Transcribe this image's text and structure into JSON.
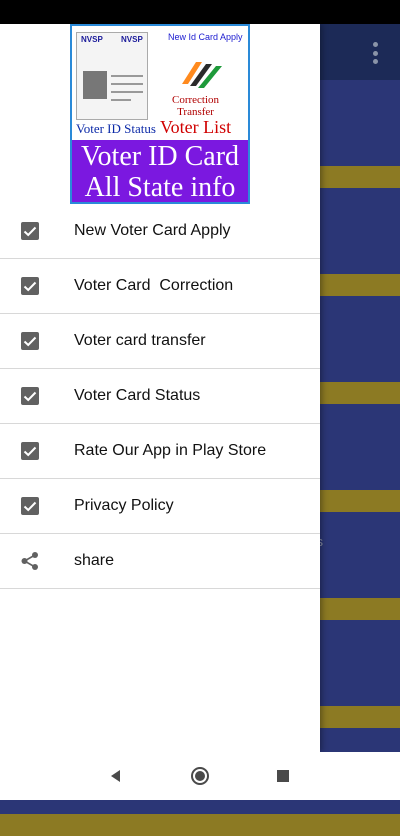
{
  "app": {
    "header": {
      "card_tags": [
        "NVSP",
        "NVSP"
      ],
      "apply_text": "New Id Card Apply",
      "correction_text": "Correction",
      "transfer_text": "Transfer",
      "status_text": "Voter ID Status",
      "list_text": "Voter List",
      "title_line1": "Voter ID Card",
      "title_line2": "All State info"
    },
    "menu": [
      {
        "label": "New Voter Card Apply",
        "icon": "checkbox-checked-icon"
      },
      {
        "label": "Voter Card  Correction",
        "icon": "checkbox-checked-icon"
      },
      {
        "label": "Voter card transfer",
        "icon": "checkbox-checked-icon"
      },
      {
        "label": "Voter Card Status",
        "icon": "checkbox-checked-icon"
      },
      {
        "label": "Rate Our App in Play Store",
        "icon": "checkbox-checked-icon"
      },
      {
        "label": "Privacy Policy",
        "icon": "checkbox-checked-icon"
      },
      {
        "label": "share",
        "icon": "share-icon"
      }
    ],
    "background_fragment": "s"
  },
  "colors": {
    "toolbar": "#1c2a57",
    "card": "#2b3676",
    "card_separator": "#8c7a23",
    "logo_band": "#7b18e0",
    "icon_gray": "#616161"
  },
  "navigation": [
    "back-icon",
    "home-icon",
    "recents-icon"
  ]
}
